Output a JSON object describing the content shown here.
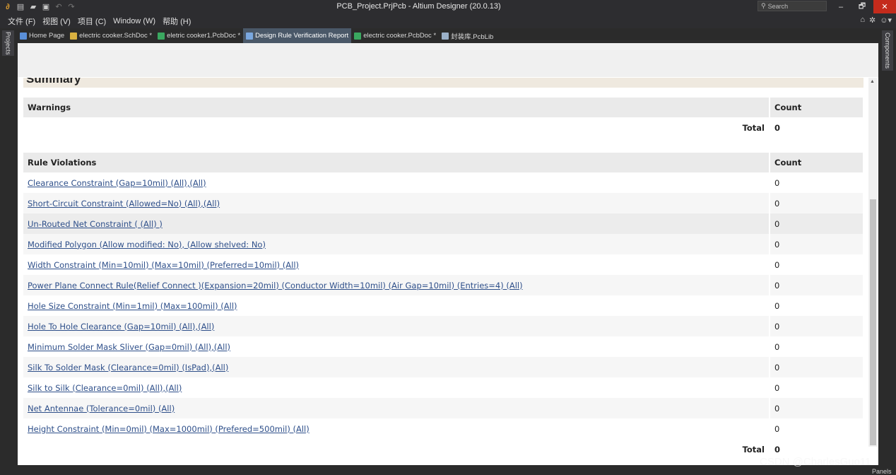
{
  "window": {
    "title": "PCB_Project.PrjPcb - Altium Designer (20.0.13)",
    "search_placeholder": "Search",
    "minimize": "–",
    "maximize": "🗗",
    "close": "✕"
  },
  "toolbar_icons": [
    "logo-icon",
    "save-all-icon",
    "open-icon",
    "open-project-icon",
    "undo-icon",
    "redo-icon"
  ],
  "menu": [
    {
      "label": "文件 (F)"
    },
    {
      "label": "视图 (V)"
    },
    {
      "label": "项目 (C)"
    },
    {
      "label": "Window (W)"
    },
    {
      "label": "帮助 (H)"
    }
  ],
  "menu_right_icons": [
    "home-icon",
    "gear-icon",
    "user-icon"
  ],
  "side_panels": {
    "left": "Projects",
    "right": "Components",
    "bottom_right": "Panels"
  },
  "tabs": [
    {
      "label": "Home Page",
      "icon": "home-icon",
      "color": "#5a8fd8",
      "active": false
    },
    {
      "label": "electric cooker.SchDoc *",
      "icon": "schematic-icon",
      "color": "#d8b040",
      "active": false
    },
    {
      "label": "eletric cooker1.PcbDoc *",
      "icon": "pcb-icon",
      "color": "#3aa860",
      "active": false
    },
    {
      "label": "Design Rule Verification Report",
      "icon": "report-icon",
      "color": "#7aa8e0",
      "active": true
    },
    {
      "label": "electric cooker.PcbDoc *",
      "icon": "pcb-icon",
      "color": "#3aa860",
      "active": false
    },
    {
      "label": "封装库.PcbLib",
      "icon": "pcblib-icon",
      "color": "#9ab0c8",
      "active": false
    }
  ],
  "report": {
    "summary_title": "Summary",
    "warnings": {
      "header": "Warnings",
      "count_header": "Count",
      "total_label": "Total",
      "total": "0"
    },
    "violations": {
      "header": "Rule Violations",
      "count_header": "Count",
      "rows": [
        {
          "rule": "Clearance Constraint (Gap=10mil) (All),(All)",
          "count": "0"
        },
        {
          "rule": "Short-Circuit Constraint (Allowed=No) (All),(All)",
          "count": "0"
        },
        {
          "rule": "Un-Routed Net Constraint ( (All) )",
          "count": "0"
        },
        {
          "rule": "Modified Polygon (Allow modified: No), (Allow shelved: No)",
          "count": "0"
        },
        {
          "rule": "Width Constraint (Min=10mil) (Max=10mil) (Preferred=10mil) (All)",
          "count": "0"
        },
        {
          "rule": "Power Plane Connect Rule(Relief Connect )(Expansion=20mil) (Conductor Width=10mil) (Air Gap=10mil) (Entries=4) (All)",
          "count": "0"
        },
        {
          "rule": "Hole Size Constraint (Min=1mil) (Max=100mil) (All)",
          "count": "0"
        },
        {
          "rule": "Hole To Hole Clearance (Gap=10mil) (All),(All)",
          "count": "0"
        },
        {
          "rule": "Minimum Solder Mask Sliver (Gap=0mil) (All),(All)",
          "count": "0"
        },
        {
          "rule": "Silk To Solder Mask (Clearance=0mil) (IsPad),(All)",
          "count": "0"
        },
        {
          "rule": "Silk to Silk (Clearance=0mil) (All),(All)",
          "count": "0"
        },
        {
          "rule": "Net Antennae (Tolerance=0mil) (All)",
          "count": "0"
        },
        {
          "rule": "Height Constraint (Min=0mil) (Max=1000mil) (Prefered=500mil) (All)",
          "count": "0"
        }
      ],
      "total_label": "Total",
      "total": "0"
    }
  },
  "watermark": "CSDN @CharlesGuo11"
}
